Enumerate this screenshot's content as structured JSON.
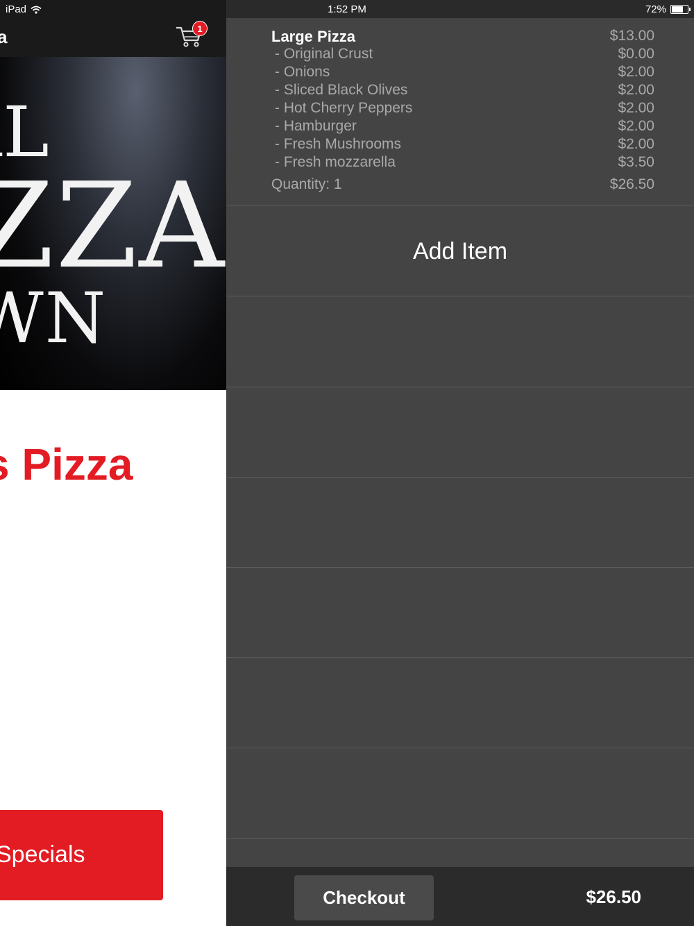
{
  "status_bar": {
    "device": "iPad",
    "time": "1:52 PM",
    "battery": "72%",
    "battery_level": 0.72
  },
  "left_pane": {
    "nav_title": "a",
    "cart_count": "1",
    "hero": {
      "line1": "AL",
      "line2": "ZZA",
      "line3": "WN"
    },
    "heading": "s Pizza",
    "specials_button": "Specials"
  },
  "cart": {
    "item": {
      "name": "Large Pizza",
      "price": "$13.00",
      "modifiers": [
        {
          "name": "- Original Crust",
          "price": "$0.00"
        },
        {
          "name": "- Onions",
          "price": "$2.00"
        },
        {
          "name": "- Sliced Black Olives",
          "price": "$2.00"
        },
        {
          "name": "- Hot Cherry Peppers",
          "price": "$2.00"
        },
        {
          "name": "- Hamburger",
          "price": "$2.00"
        },
        {
          "name": "- Fresh Mushrooms",
          "price": "$2.00"
        },
        {
          "name": "- Fresh mozzarella",
          "price": "$3.50"
        }
      ],
      "quantity_label": "Quantity: 1",
      "line_total": "$26.50"
    },
    "add_item_label": "Add Item",
    "checkout_label": "Checkout",
    "total": "$26.50"
  },
  "colors": {
    "accent_red": "#e31b23",
    "panel_bg": "#444444",
    "footer_bg": "#2b2b2b"
  }
}
